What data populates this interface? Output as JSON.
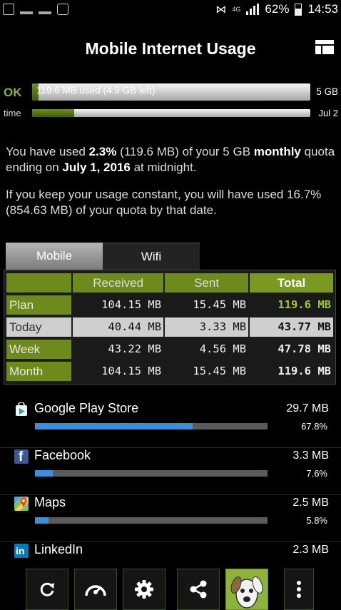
{
  "status_bar": {
    "network": "4G",
    "battery": "62%",
    "time": "14:53"
  },
  "header": {
    "title": "Mobile Internet Usage",
    "menu_icon": "layout-grid-icon"
  },
  "usage": {
    "status": "OK",
    "used_text": "119.6 MB used (4.9 GB left)",
    "quota": "5 GB",
    "used_fraction": 0.023,
    "time_label": "time",
    "period_end": "Jul 2",
    "time_fraction": 0.15
  },
  "summary": {
    "p1": {
      "a": "You have used ",
      "pct": "2.3%",
      "b": " (119.6 MB) of your 5 GB ",
      "period": "monthly",
      "c": " quota ending on ",
      "date": "July 1, 2016",
      "d": " at midnight."
    },
    "p2": "If you keep your usage constant, you will have used 16.7% (854.63 MB) of your quota by that date."
  },
  "tabs": [
    {
      "label": "Mobile",
      "active": true
    },
    {
      "label": "Wifi",
      "active": false
    }
  ],
  "table": {
    "headers": [
      "",
      "Received",
      "Sent",
      "Total"
    ],
    "rows": [
      {
        "label": "Plan",
        "received": "104.15 MB",
        "sent": "15.45 MB",
        "total": "119.6 MB"
      },
      {
        "label": "Today",
        "received": "40.44 MB",
        "sent": "3.33 MB",
        "total": "43.77 MB"
      },
      {
        "label": "Week",
        "received": "43.22 MB",
        "sent": "4.56 MB",
        "total": "47.78 MB"
      },
      {
        "label": "Month",
        "received": "104.15 MB",
        "sent": "15.45 MB",
        "total": "119.6 MB"
      }
    ]
  },
  "apps": [
    {
      "name": "Google Play Store",
      "size": "29.7 MB",
      "percent": "67.8%",
      "fraction": 0.678,
      "icon": "play-store-icon",
      "color": "#3a8fd6"
    },
    {
      "name": "Facebook",
      "size": "3.3 MB",
      "percent": "7.6%",
      "fraction": 0.076,
      "icon": "facebook-icon",
      "color": "#3a8fd6"
    },
    {
      "name": "Maps",
      "size": "2.5 MB",
      "percent": "5.8%",
      "fraction": 0.058,
      "icon": "maps-icon",
      "color": "#3a8fd6"
    },
    {
      "name": "LinkedIn",
      "size": "2.3 MB",
      "percent": "",
      "fraction": 0.053,
      "icon": "linkedin-icon",
      "color": "#3a8fd6"
    }
  ],
  "toolbar": {
    "buttons": [
      "refresh-icon",
      "speedometer-icon",
      "settings-icon",
      "share-icon",
      "dog-logo-icon",
      "more-vert-icon"
    ]
  },
  "colors": {
    "accent_green": "#8db33a",
    "bar_blue": "#3a8fd6"
  }
}
